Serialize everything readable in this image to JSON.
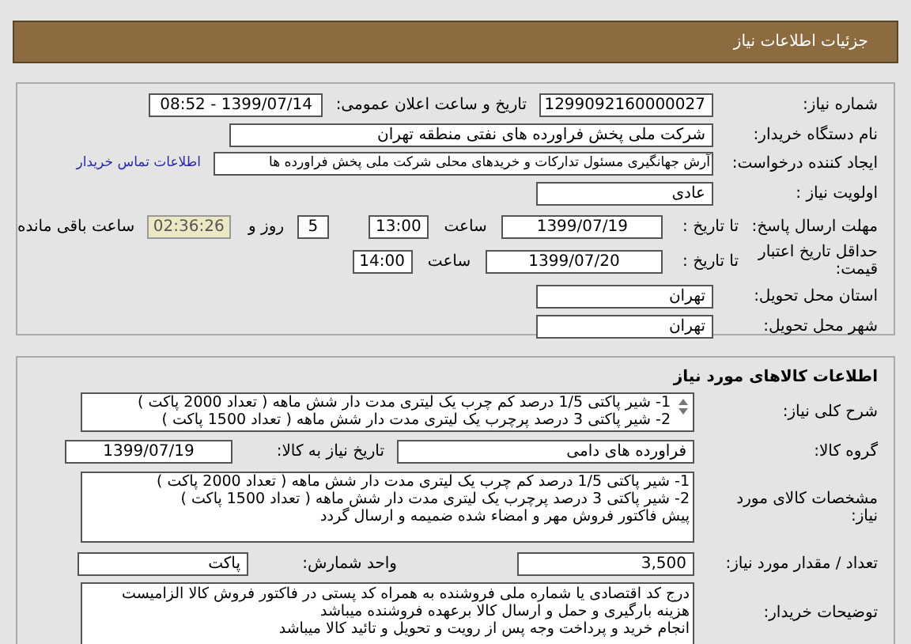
{
  "header": {
    "title": "جزئیات اطلاعات نیاز"
  },
  "need": {
    "number_label": "شماره نیاز:",
    "number": "1299092160000027",
    "announce_label": "تاریخ و ساعت اعلان عمومی:",
    "announce": "1399/07/14 - 08:52",
    "buyer_label": "نام دستگاه خریدار:",
    "buyer": "شرکت ملی پخش فراورده های نفتی منطقه تهران",
    "creator_label": "ایجاد کننده درخواست:",
    "creator": "آرش جهانگیری مسئول تدارکات و خریدهای محلی  شرکت ملی پخش فراورده ها",
    "contact_link": "اطلاعات تماس خریدار",
    "priority_label": "اولویت نیاز :",
    "priority": "عادی",
    "deadline_label": "مهلت ارسال پاسخ:",
    "deadline_to": "تا تاریخ :",
    "deadline_date": "1399/07/19",
    "deadline_time_label": "ساعت",
    "deadline_time": "13:00",
    "days": "5",
    "days_label": "روز و",
    "remaining": "02:36:26",
    "remaining_label": "ساعت باقی مانده",
    "validity_label": "حداقل تاریخ اعتبار قیمت:",
    "validity_to": "تا تاریخ :",
    "validity_date": "1399/07/20",
    "validity_time_label": "ساعت",
    "validity_time": "14:00",
    "province_label": "استان محل تحویل:",
    "province": "تهران",
    "city_label": "شهر محل تحویل:",
    "city": "تهران"
  },
  "goods": {
    "title": "اطلاعات کالاهای مورد نیاز",
    "description_label": "شرح کلی نیاز:",
    "description": [
      "1- شیر پاکتی 1/5 درصد کم چرب یک لیتری مدت دار شش ماهه ( تعداد 2000 پاکت )",
      "2- شیر پاکتی 3 درصد پرچرب یک لیتری مدت دار شش ماهه ( تعداد 1500 پاکت )"
    ],
    "group_label": "گروه کالا:",
    "group": "فراورده های دامی",
    "need_date_label": "تاریخ نیاز به کالا:",
    "need_date": "1399/07/19",
    "specs_label": "مشخصات کالای مورد نیاز:",
    "specs": [
      "1- شیر پاکتی 1/5 درصد کم چرب یک لیتری مدت دار شش ماهه ( تعداد 2000 پاکت )",
      "2- شیر پاکتی 3 درصد پرچرب یک لیتری مدت دار شش ماهه ( تعداد 1500 پاکت )",
      "پیش فاکتور فروش مهر و امضاء شده ضمیمه و ارسال گردد"
    ],
    "qty_label": "تعداد / مقدار مورد نیاز:",
    "qty": "3,500",
    "unit_label": "واحد شمارش:",
    "unit": "پاکت",
    "notes_label": "توضیحات خریدار:",
    "notes": [
      "درج کد اقتصادی یا شماره ملی فروشنده به همراه کد پستی در فاکتور فروش کالا الزامیست",
      "هزینه بارگیری و حمل و ارسال کالا برعهده فروشنده میباشد",
      "انجام خرید و پرداخت وجه پس از رویت و تحویل و تائید کالا میباشد"
    ]
  }
}
